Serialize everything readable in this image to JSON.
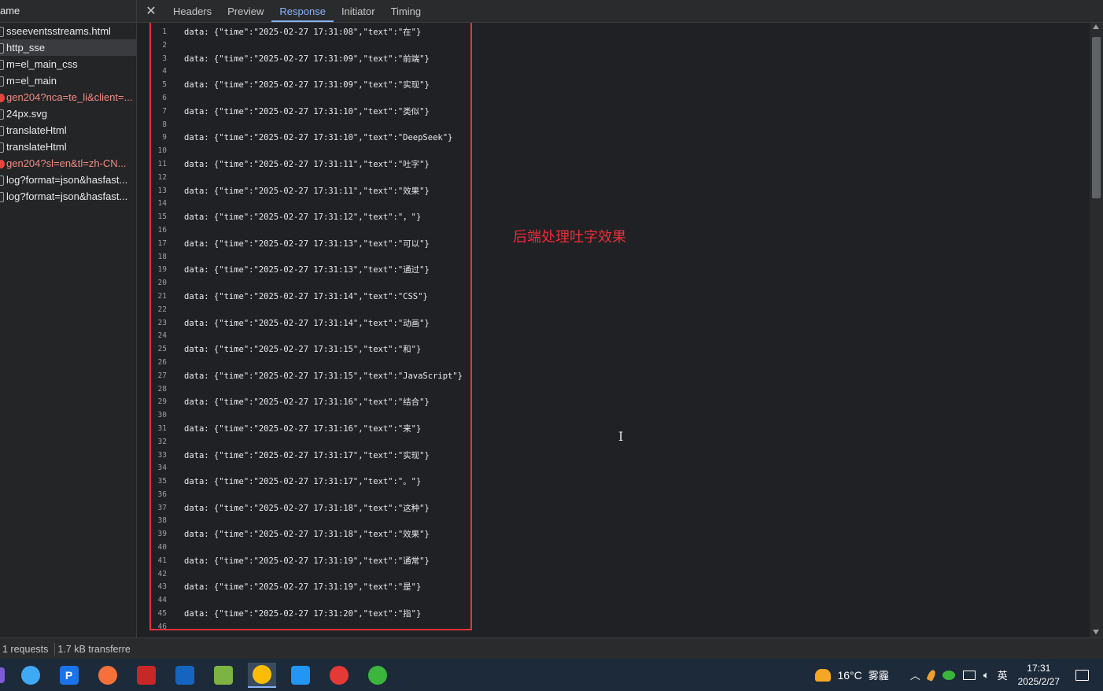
{
  "left_panel": {
    "header": "ame",
    "requests": [
      {
        "name": "sseeventsstreams.html",
        "status": "normal"
      },
      {
        "name": "http_sse",
        "status": "selected"
      },
      {
        "name": "m=el_main_css",
        "status": "normal"
      },
      {
        "name": "m=el_main",
        "status": "normal"
      },
      {
        "name": "gen204?nca=te_li&client=...",
        "status": "error"
      },
      {
        "name": "24px.svg",
        "status": "normal"
      },
      {
        "name": "translateHtml",
        "status": "normal"
      },
      {
        "name": "translateHtml",
        "status": "normal"
      },
      {
        "name": "gen204?sl=en&tl=zh-CN...",
        "status": "error"
      },
      {
        "name": "log?format=json&hasfast...",
        "status": "normal"
      },
      {
        "name": "log?format=json&hasfast...",
        "status": "normal"
      }
    ]
  },
  "tabs": {
    "close": "✕",
    "items": [
      "Headers",
      "Preview",
      "Response",
      "Initiator",
      "Timing"
    ],
    "active": "Response"
  },
  "response": {
    "lines": [
      {
        "n": "1",
        "text": "data: {\"time\":\"2025-02-27 17:31:08\",\"text\":\"在\"}"
      },
      {
        "n": "2",
        "text": ""
      },
      {
        "n": "3",
        "text": "data: {\"time\":\"2025-02-27 17:31:09\",\"text\":\"前端\"}"
      },
      {
        "n": "4",
        "text": ""
      },
      {
        "n": "5",
        "text": "data: {\"time\":\"2025-02-27 17:31:09\",\"text\":\"实现\"}"
      },
      {
        "n": "6",
        "text": ""
      },
      {
        "n": "7",
        "text": "data: {\"time\":\"2025-02-27 17:31:10\",\"text\":\"类似\"}"
      },
      {
        "n": "8",
        "text": ""
      },
      {
        "n": "9",
        "text": "data: {\"time\":\"2025-02-27 17:31:10\",\"text\":\"DeepSeek\"}"
      },
      {
        "n": "10",
        "text": ""
      },
      {
        "n": "11",
        "text": "data: {\"time\":\"2025-02-27 17:31:11\",\"text\":\"吐字\"}"
      },
      {
        "n": "12",
        "text": ""
      },
      {
        "n": "13",
        "text": "data: {\"time\":\"2025-02-27 17:31:11\",\"text\":\"效果\"}"
      },
      {
        "n": "14",
        "text": ""
      },
      {
        "n": "15",
        "text": "data: {\"time\":\"2025-02-27 17:31:12\",\"text\":\"，\"}"
      },
      {
        "n": "16",
        "text": ""
      },
      {
        "n": "17",
        "text": "data: {\"time\":\"2025-02-27 17:31:13\",\"text\":\"可以\"}"
      },
      {
        "n": "18",
        "text": ""
      },
      {
        "n": "19",
        "text": "data: {\"time\":\"2025-02-27 17:31:13\",\"text\":\"通过\"}"
      },
      {
        "n": "20",
        "text": ""
      },
      {
        "n": "21",
        "text": "data: {\"time\":\"2025-02-27 17:31:14\",\"text\":\"CSS\"}"
      },
      {
        "n": "22",
        "text": ""
      },
      {
        "n": "23",
        "text": "data: {\"time\":\"2025-02-27 17:31:14\",\"text\":\"动画\"}"
      },
      {
        "n": "24",
        "text": ""
      },
      {
        "n": "25",
        "text": "data: {\"time\":\"2025-02-27 17:31:15\",\"text\":\"和\"}"
      },
      {
        "n": "26",
        "text": ""
      },
      {
        "n": "27",
        "text": "data: {\"time\":\"2025-02-27 17:31:15\",\"text\":\"JavaScript\"}"
      },
      {
        "n": "28",
        "text": ""
      },
      {
        "n": "29",
        "text": "data: {\"time\":\"2025-02-27 17:31:16\",\"text\":\"结合\"}"
      },
      {
        "n": "30",
        "text": ""
      },
      {
        "n": "31",
        "text": "data: {\"time\":\"2025-02-27 17:31:16\",\"text\":\"来\"}"
      },
      {
        "n": "32",
        "text": ""
      },
      {
        "n": "33",
        "text": "data: {\"time\":\"2025-02-27 17:31:17\",\"text\":\"实现\"}"
      },
      {
        "n": "34",
        "text": ""
      },
      {
        "n": "35",
        "text": "data: {\"time\":\"2025-02-27 17:31:17\",\"text\":\"。\"}"
      },
      {
        "n": "36",
        "text": ""
      },
      {
        "n": "37",
        "text": "data: {\"time\":\"2025-02-27 17:31:18\",\"text\":\"这种\"}"
      },
      {
        "n": "38",
        "text": ""
      },
      {
        "n": "39",
        "text": "data: {\"time\":\"2025-02-27 17:31:18\",\"text\":\"效果\"}"
      },
      {
        "n": "40",
        "text": ""
      },
      {
        "n": "41",
        "text": "data: {\"time\":\"2025-02-27 17:31:19\",\"text\":\"通常\"}"
      },
      {
        "n": "42",
        "text": ""
      },
      {
        "n": "43",
        "text": "data: {\"time\":\"2025-02-27 17:31:19\",\"text\":\"是\"}"
      },
      {
        "n": "44",
        "text": ""
      },
      {
        "n": "45",
        "text": "data: {\"time\":\"2025-02-27 17:31:20\",\"text\":\"指\"}"
      },
      {
        "n": "46",
        "text": ""
      }
    ],
    "annotation": "后端处理吐字效果",
    "highlight_color": "#e8333b"
  },
  "status_bar": {
    "requests": "1 requests",
    "transferred": "1.7 kB transferre"
  },
  "taskbar": {
    "apps": [
      {
        "icon": "browser-swirl-icon",
        "color": "#3fa9f5"
      },
      {
        "icon": "p-app-icon",
        "label": "P",
        "color": "#1a73e8"
      },
      {
        "icon": "postman-icon",
        "color": "#f4713b"
      },
      {
        "icon": "terminal-icon",
        "color": "#c62828"
      },
      {
        "icon": "maps-pin-icon",
        "color": "#1565c0"
      },
      {
        "icon": "notepad-icon",
        "color": "#7cb342"
      },
      {
        "icon": "chrome-icon",
        "color": "#fbbc04",
        "active": true
      },
      {
        "icon": "vscode-icon",
        "color": "#2196f3"
      },
      {
        "icon": "netease-music-icon",
        "color": "#e53935"
      },
      {
        "icon": "wechat-icon",
        "color": "#3bb53b"
      }
    ],
    "weather_temp": "16°C",
    "weather_desc": "雾霾",
    "ime": "英",
    "time": "17:31",
    "date": "2025/2/27"
  }
}
